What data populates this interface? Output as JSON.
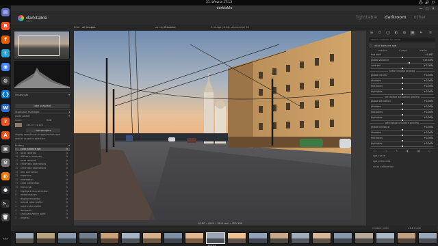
{
  "system": {
    "clock": "31. března 17:13",
    "tray": "🖧 🔊 ⏻"
  },
  "window": {
    "title": "darktable",
    "minimize": "—",
    "maximize": "□",
    "close": "✕"
  },
  "header": {
    "app_name": "darktable",
    "app_version": "3.8.1",
    "views": {
      "lighttable": "lighttable",
      "darkroom": "darkroom",
      "other": "other"
    }
  },
  "filterbar": {
    "filter": "filter",
    "all_images": "all images",
    "sort_by": "sort by",
    "filename": "filename",
    "counter": "9 image (#44) selected of 36"
  },
  "dock": {
    "icons": [
      {
        "name": "files-icon",
        "glyph": "▤",
        "color": "#5c6bc0"
      },
      {
        "name": "brave-icon",
        "glyph": "B",
        "color": "#fb542b"
      },
      {
        "name": "firefox-icon",
        "glyph": "f",
        "color": "#e66000"
      },
      {
        "name": "telegram-icon",
        "glyph": "✈",
        "color": "#2aa3d7"
      },
      {
        "name": "chromium-icon",
        "glyph": "◉",
        "color": "#4285f4"
      },
      {
        "name": "darktable-icon",
        "glyph": "◍",
        "color": "#3a3a3a"
      },
      {
        "name": "vscode-icon",
        "glyph": "❮❯",
        "color": "#0078d4"
      },
      {
        "name": "writer-icon",
        "glyph": "W",
        "color": "#2a6bd1"
      },
      {
        "name": "help-icon",
        "glyph": "?",
        "color": "#e95420"
      },
      {
        "name": "appstore-icon",
        "glyph": "A",
        "color": "#e95420"
      },
      {
        "name": "system-monitor-icon",
        "glyph": "▣",
        "color": "#555"
      },
      {
        "name": "settings-icon",
        "glyph": "⚙",
        "color": "#777"
      },
      {
        "name": "blender-icon",
        "glyph": "◐",
        "color": "#e87d0d"
      },
      {
        "name": "obs-icon",
        "glyph": "●",
        "color": "#302e31"
      },
      {
        "name": "terminal-icon",
        "glyph": ">_",
        "color": "#2c2c2c"
      },
      {
        "name": "trash-icon",
        "glyph": "🗑",
        "color": "#444"
      }
    ],
    "show_apps": "⋯"
  },
  "left": {
    "snapshots_label": "snapshots",
    "take_snapshot": "take snapshot",
    "duplicate_manager": "duplicate manager",
    "color_picker": "color picker",
    "picker_mode": "mean",
    "picker_format": "RGB",
    "picker_values": "133   07   74   103",
    "add_sample": "live samples",
    "display_samples": "display samples on image/vectorscope",
    "restrict_histogram": "restrict scope to selection",
    "history_label": "history",
    "history": [
      {
        "idx": "20",
        "name": "color balance rgb",
        "selected": true
      },
      {
        "idx": "19",
        "name": "local contrast",
        "selected": false
      },
      {
        "idx": "18",
        "name": "diffuse or sharpen",
        "selected": false
      },
      {
        "idx": "17",
        "name": "haze removal",
        "selected": false
      },
      {
        "idx": "16",
        "name": "chromatic aberrations",
        "selected": false
      },
      {
        "idx": "15",
        "name": "chromatic aberrations",
        "selected": false
      },
      {
        "idx": "14",
        "name": "lens correction",
        "selected": false
      },
      {
        "idx": "13",
        "name": "exposure",
        "selected": false
      },
      {
        "idx": "12",
        "name": "orientation",
        "selected": false
      },
      {
        "idx": "11",
        "name": "color calibration",
        "selected": false
      },
      {
        "idx": "10",
        "name": "filmic rgb",
        "selected": false
      },
      {
        "idx": "9",
        "name": "highlight reconstruction",
        "selected": false
      },
      {
        "idx": "8",
        "name": "white balance",
        "selected": false
      },
      {
        "idx": "7",
        "name": "display encoding",
        "selected": false
      },
      {
        "idx": "6",
        "name": "output color profile",
        "selected": false
      },
      {
        "idx": "5",
        "name": "input color profile",
        "selected": false
      },
      {
        "idx": "4",
        "name": "demosaic",
        "selected": false
      },
      {
        "idx": "3",
        "name": "raw black/white point",
        "selected": false
      },
      {
        "idx": "2",
        "name": "original",
        "selected": false
      }
    ]
  },
  "center": {
    "caption": "1/160 • f/8.0 • 28.0 mm • ISO 100"
  },
  "right": {
    "search_placeholder": "search modules by name",
    "module_title": "color balance rgb",
    "tabs": [
      "master",
      "4 ways",
      "masks"
    ],
    "sliders_top": [
      {
        "label": "hue shift",
        "value": "+0.00°",
        "pos": 0.5
      },
      {
        "label": "global vibrance",
        "value": "+17.33%",
        "pos": 0.62
      },
      {
        "label": "contrast",
        "value": "+0.00%",
        "pos": 0.5
      }
    ],
    "linear_section": "linear chroma grading",
    "sliders_linear": [
      {
        "label": "global chroma",
        "value": "+0.00%",
        "pos": 0.5
      },
      {
        "label": "shadows",
        "value": "+0.00%",
        "pos": 0.5
      },
      {
        "label": "mid-tones",
        "value": "+0.00%",
        "pos": 0.5
      },
      {
        "label": "highlights",
        "value": "+0.00%",
        "pos": 0.5
      }
    ],
    "perceptual_section": "perceptual saturation grading",
    "sliders_perceptual": [
      {
        "label": "global saturation",
        "value": "+0.00%",
        "pos": 0.5
      },
      {
        "label": "shadows",
        "value": "+0.00%",
        "pos": 0.5
      },
      {
        "label": "mid-tones",
        "value": "+0.00%",
        "pos": 0.5
      },
      {
        "label": "highlights",
        "value": "+0.00%",
        "pos": 0.5
      }
    ],
    "brilliance_section": "perceptual brilliance grading",
    "sliders_brilliance": [
      {
        "label": "global brilliance",
        "value": "+0.00%",
        "pos": 0.5
      },
      {
        "label": "shadows",
        "value": "+0.00%",
        "pos": 0.5
      },
      {
        "label": "mid-tones",
        "value": "+0.00%",
        "pos": 0.5
      },
      {
        "label": "highlights",
        "value": "+0.00%",
        "pos": 0.5
      }
    ],
    "collapsed": [
      "rgb curve",
      "rgb primaries",
      "color calibration"
    ]
  },
  "bottom": {
    "left": "module order",
    "right": "v3.8 mode"
  }
}
